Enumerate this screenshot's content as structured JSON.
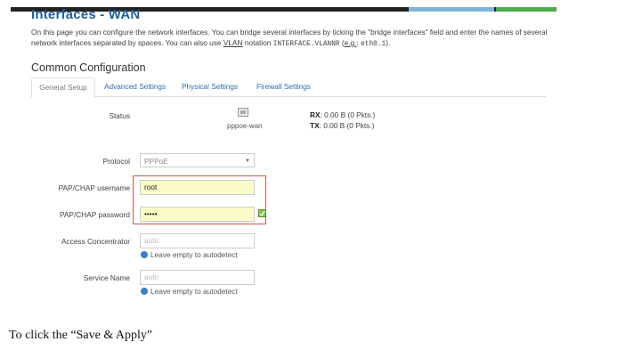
{
  "page": {
    "title": "Interfaces - WAN",
    "description_part1": "On this page you can configure the network interfaces. You can bridge several interfaces by ticking the \"bridge interfaces\" field and enter the names of several",
    "description_part2": "network interfaces separated by spaces. You can also use ",
    "description_vlan": "VLAN",
    "description_notation": " notation ",
    "description_mono1": "INTERFACE.VLANNR",
    "description_eg_open": " (",
    "description_eg": "e.g.",
    "description_colon": ": ",
    "description_mono2": "eth0.1",
    "description_end": ")."
  },
  "section": {
    "title": "Common Configuration"
  },
  "tabs": [
    {
      "label": "General Setup",
      "active": true
    },
    {
      "label": "Advanced Settings",
      "active": false
    },
    {
      "label": "Physical Settings",
      "active": false
    },
    {
      "label": "Firewall Settings",
      "active": false
    }
  ],
  "status": {
    "label": "Status",
    "device": "pppoe-wan",
    "rx_label": "RX",
    "rx_value": ": 0.00 B (0 Pkts.)",
    "tx_label": "TX",
    "tx_value": ": 0.00 B (0 Pkts.)",
    "icon": "network-port-icon"
  },
  "protocol": {
    "label": "Protocol",
    "value": "PPPoE"
  },
  "username": {
    "label": "PAP/CHAP username",
    "value": "root"
  },
  "password": {
    "label": "PAP/CHAP password",
    "value": "•••••"
  },
  "access_concentrator": {
    "label": "Access Concentrator",
    "placeholder": "auto",
    "hint": "Leave empty to autodetect"
  },
  "service_name": {
    "label": "Service Name",
    "placeholder": "auto",
    "hint": "Leave empty to autodetect"
  },
  "caption": "To click the “Save & Apply”",
  "colors": {
    "title": "#1f5f9f",
    "highlight_border": "#d9534f",
    "input_highlight": "#fbfbc8",
    "tab_link": "#2a6db0"
  }
}
